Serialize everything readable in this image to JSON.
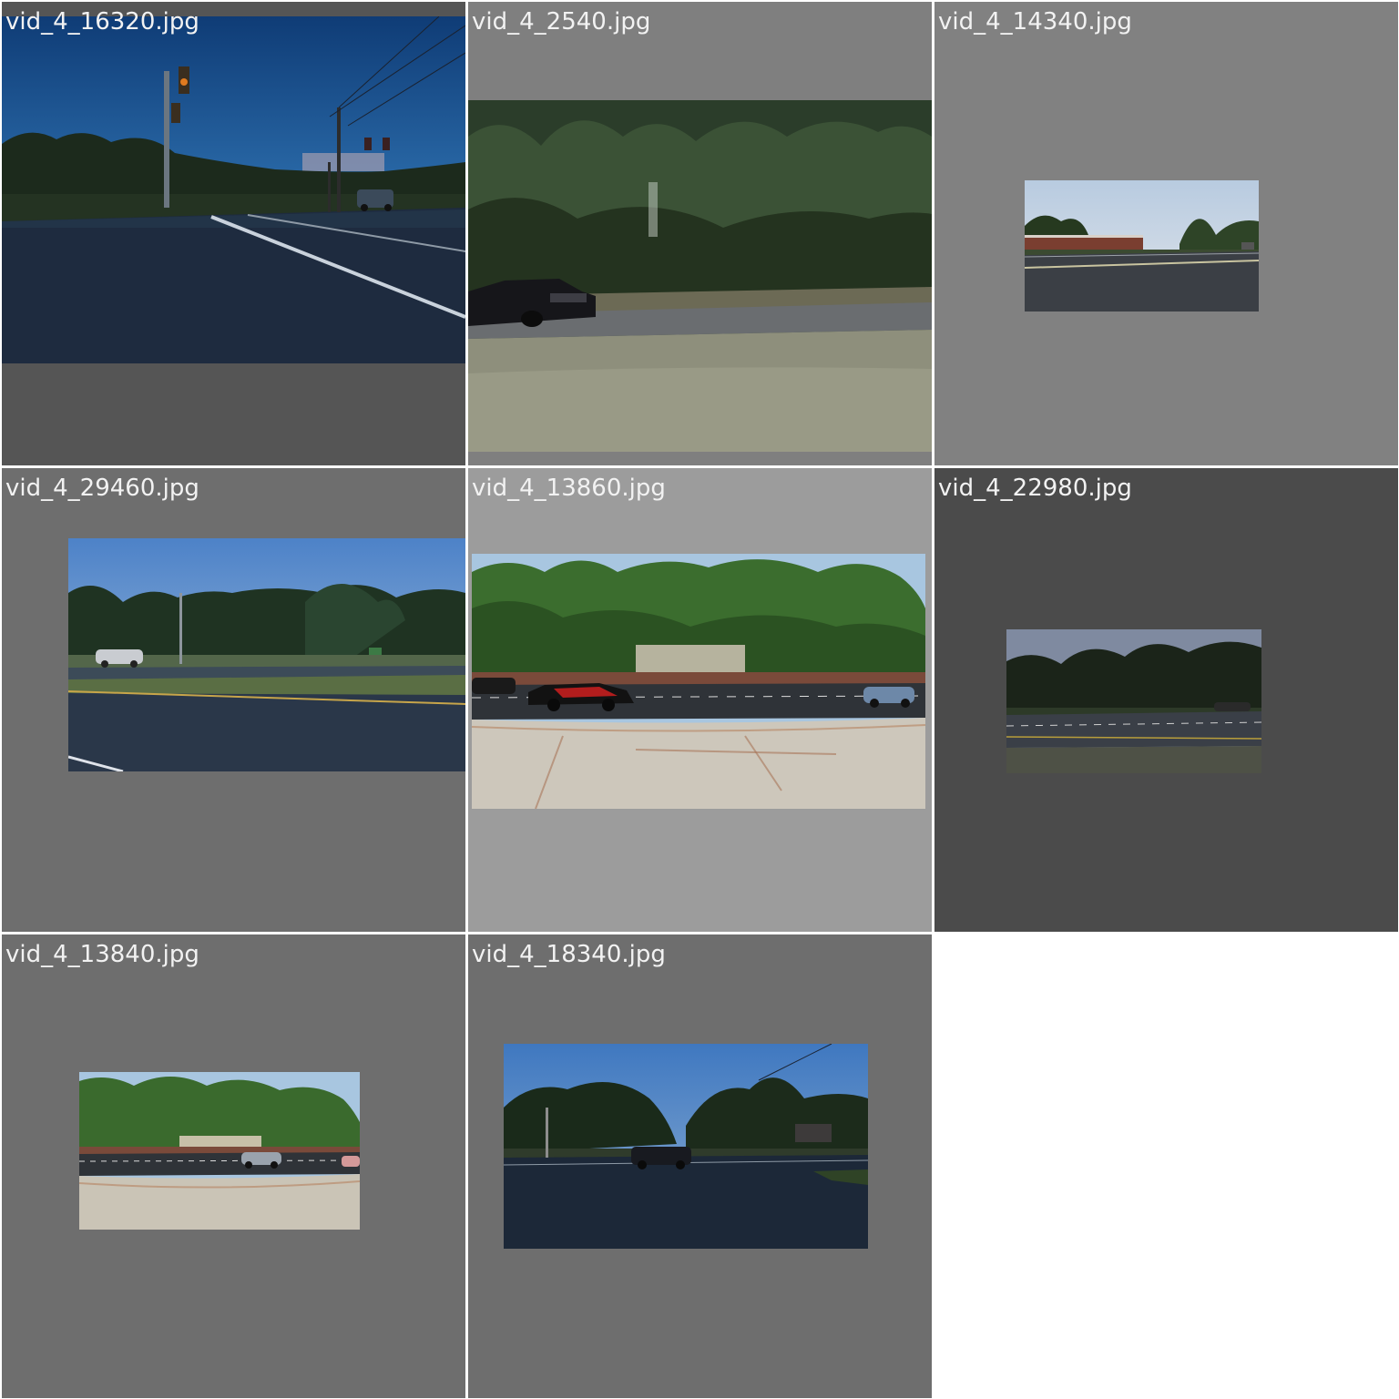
{
  "grid": {
    "tiles": [
      {
        "filename": "vid_4_16320.jpg",
        "scene": "Dusk intersection with traffic lights, utility poles and a car on the road",
        "bg": "#555555"
      },
      {
        "filename": "vid_4_2540.jpg",
        "scene": "Motion-blurred black pickup truck passing a tree line",
        "bg": "#7f7f7f"
      },
      {
        "filename": "vid_4_14340.jpg",
        "scene": "Small wide-angle view of road with low building and trees",
        "bg": "#818181"
      },
      {
        "filename": "vid_4_29460.jpg",
        "scene": "Wide road with median, trees and a white SUV",
        "bg": "#6e6e6e"
      },
      {
        "filename": "vid_4_13860.jpg",
        "scene": "Sidewalk foreground, red sports car and cars passing trees",
        "bg": "#9c9c9c"
      },
      {
        "filename": "vid_4_22980.jpg",
        "scene": "Road in dim light with dark tree line and a car",
        "bg": "#4b4b4b"
      },
      {
        "filename": "vid_4_13840.jpg",
        "scene": "Sidewalk and road with silver SUV passing trees",
        "bg": "#6e6e6e"
      },
      {
        "filename": "vid_4_18340.jpg",
        "scene": "Intersection at dusk with dark SUV and trees",
        "bg": "#6e6e6e"
      }
    ]
  }
}
